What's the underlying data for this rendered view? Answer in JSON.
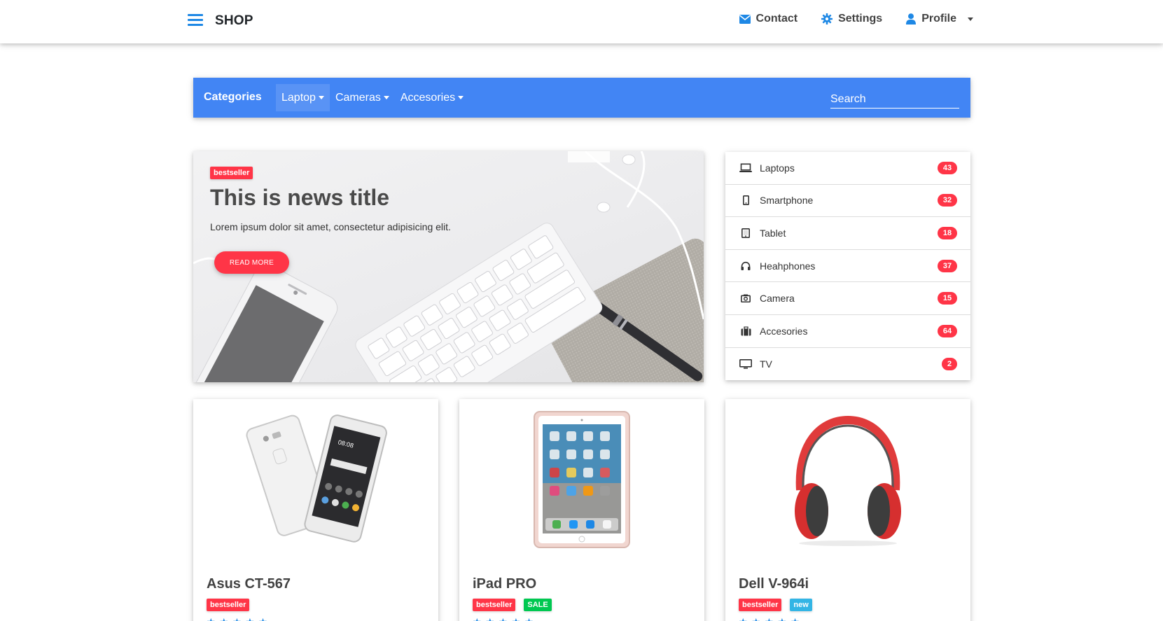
{
  "navbar": {
    "brand": "SHOP",
    "links": [
      {
        "label": "Contact",
        "icon": "envelope-icon"
      },
      {
        "label": "Settings",
        "icon": "gear-icon"
      },
      {
        "label": "Profile",
        "icon": "user-icon"
      }
    ]
  },
  "categories_bar": {
    "title": "Categories",
    "menu": [
      {
        "label": "Laptop",
        "active": true
      },
      {
        "label": "Cameras",
        "active": false
      },
      {
        "label": "Accesories",
        "active": false
      }
    ],
    "search_placeholder": "Search"
  },
  "hero": {
    "badge": "bestseller",
    "title": "This is news title",
    "text": "Lorem ipsum dolor sit amet, consectetur adipisicing elit.",
    "button": "READ MORE"
  },
  "category_list": [
    {
      "label": "Laptops",
      "count": "43",
      "icon": "laptop-icon"
    },
    {
      "label": "Smartphone",
      "count": "32",
      "icon": "smartphone-icon"
    },
    {
      "label": "Tablet",
      "count": "18",
      "icon": "tablet-icon"
    },
    {
      "label": "Heahphones",
      "count": "37",
      "icon": "headphones-icon"
    },
    {
      "label": "Camera",
      "count": "15",
      "icon": "camera-icon"
    },
    {
      "label": "Accesories",
      "count": "64",
      "icon": "suitcase-icon"
    },
    {
      "label": "TV",
      "count": "2",
      "icon": "tv-icon"
    }
  ],
  "products": [
    {
      "name": "Asus CT-567",
      "tags": [
        "bestseller"
      ],
      "image": "smartphone-image"
    },
    {
      "name": "iPad PRO",
      "tags": [
        "bestseller",
        "SALE"
      ],
      "image": "tablet-image"
    },
    {
      "name": "Dell V-964i",
      "tags": [
        "bestseller",
        "new"
      ],
      "image": "headphones-image"
    }
  ],
  "colors": {
    "primary": "#4285f4",
    "accent_blue": "#1e88e5",
    "badge_red": "#ff3547",
    "badge_green": "#00c851",
    "badge_cyan": "#33b5e5"
  }
}
